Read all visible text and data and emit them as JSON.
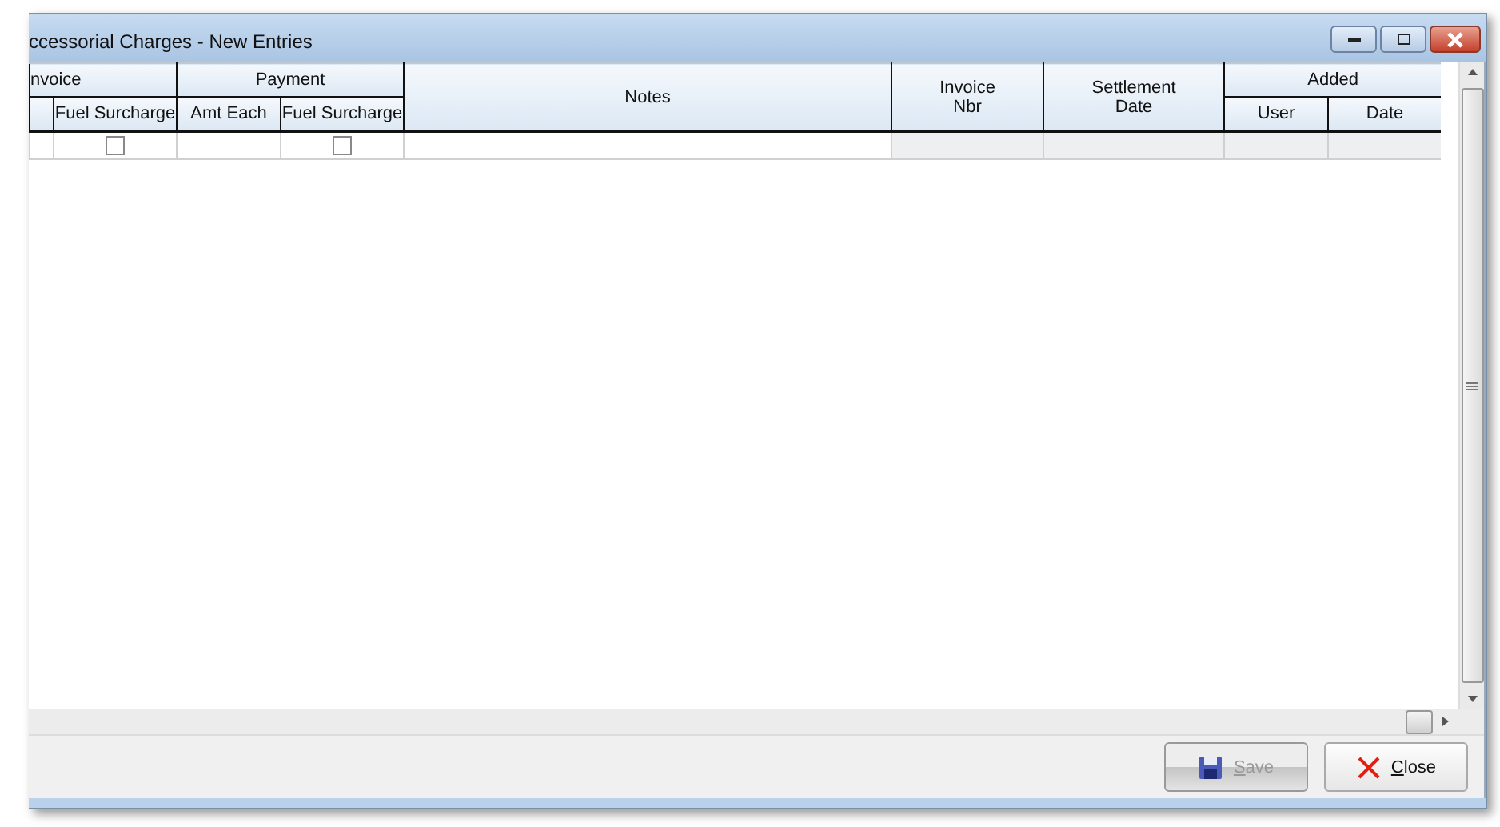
{
  "window": {
    "title": "ccessorial Charges - New Entries"
  },
  "grid": {
    "groups": [
      {
        "kind": "group",
        "label": "nvoice",
        "columns": [
          {
            "kind": "text"
          },
          {
            "label": "Fuel Surcharge",
            "kind": "check"
          }
        ]
      },
      {
        "kind": "group",
        "label": "Payment",
        "columns": [
          {
            "label": "Amt Each",
            "kind": "text"
          },
          {
            "label": "Fuel Surcharge",
            "kind": "check"
          }
        ]
      },
      {
        "kind": "single",
        "label": "Notes",
        "columns": [
          {
            "kind": "text"
          }
        ]
      },
      {
        "kind": "single",
        "label": "Invoice Nbr",
        "columns": [
          {
            "kind": "readonly"
          }
        ]
      },
      {
        "kind": "single",
        "label": "Settlement Date",
        "columns": [
          {
            "kind": "readonly"
          }
        ]
      },
      {
        "kind": "group",
        "label": "Added",
        "columns": [
          {
            "label": "User",
            "kind": "readonly"
          },
          {
            "label": "Date",
            "kind": "readonly"
          }
        ]
      }
    ],
    "rows": [
      {
        "cells": [
          {},
          {
            "checked": false
          },
          {},
          {
            "checked": false
          },
          {},
          {},
          {},
          {},
          {}
        ]
      }
    ]
  },
  "buttons": [
    {
      "label": "Save",
      "kind": "save",
      "disabled": true
    },
    {
      "label": "Close",
      "kind": "close",
      "disabled": false
    }
  ]
}
